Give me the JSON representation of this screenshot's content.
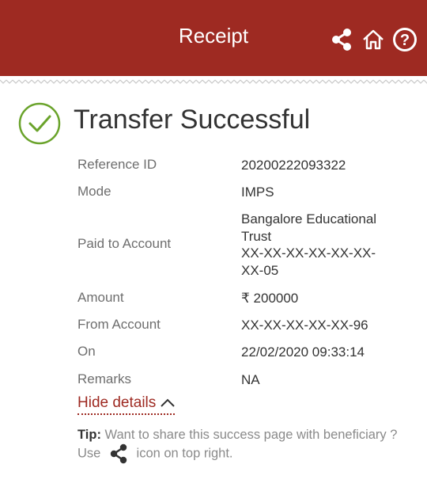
{
  "header": {
    "title": "Receipt",
    "icons": [
      "share-icon",
      "home-icon",
      "help-icon"
    ],
    "background_color": "#9e2a22"
  },
  "status": {
    "title": "Transfer Successful",
    "icon": "check-circle-icon",
    "icon_color": "#6aa32b"
  },
  "details": [
    {
      "label": "Reference ID",
      "value": "20200222093322"
    },
    {
      "label": "Mode",
      "value": "IMPS"
    },
    {
      "label": "Paid to Account",
      "value_lines": [
        "Bangalore Educational",
        "Trust",
        "XX-XX-XX-XX-XX-XX-",
        "XX-05"
      ]
    },
    {
      "label": "Amount",
      "value": "₹ 200000"
    },
    {
      "label": "From Account",
      "value": "XX-XX-XX-XX-XX-96"
    },
    {
      "label": "On",
      "value": "22/02/2020 09:33:14"
    },
    {
      "label": "Remarks",
      "value": "NA"
    }
  ],
  "toggle": {
    "label": "Hide details",
    "icon": "chevron-up-icon"
  },
  "tip": {
    "prefix": "Tip:",
    "text_before": " Want to share this success page with beneficiary ? Use ",
    "icon": "share-icon",
    "text_after": " icon on top right."
  }
}
